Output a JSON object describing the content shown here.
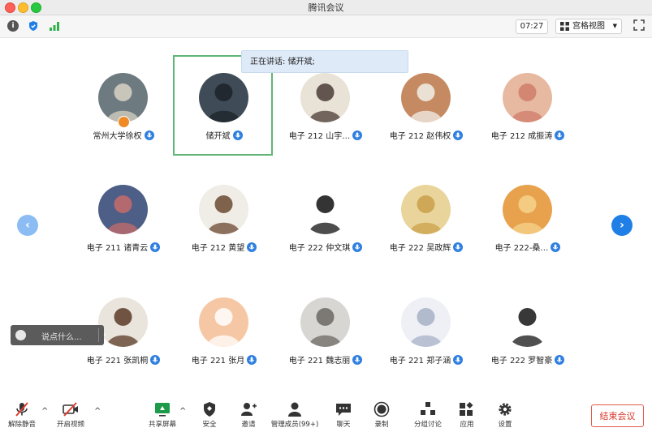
{
  "window": {
    "title": "腾讯会议"
  },
  "toolbar": {
    "timer": "07:27",
    "view_label": "宫格视图"
  },
  "speaking": {
    "text": "正在讲话: 储开斌;"
  },
  "participants": [
    {
      "name": "常州大学徐权",
      "bg": "#6d7b80",
      "fg": "#d8d2c4"
    },
    {
      "name": "储开斌",
      "bg": "#3f4c57",
      "fg": "#1c2228"
    },
    {
      "name": "电子 212 山宇…",
      "bg": "#e9e2d6",
      "fg": "#4a3b36"
    },
    {
      "name": "电子 212 赵伟权",
      "bg": "#c58a62",
      "fg": "#f1efe9"
    },
    {
      "name": "电子 212 成振涛",
      "bg": "#e6b9a0",
      "fg": "#cf7c6a"
    },
    {
      "name": "电子 211 诸青云",
      "bg": "#4d5f86",
      "fg": "#c76b6b"
    },
    {
      "name": "电子 212 黄望",
      "bg": "#f0ece6",
      "fg": "#6b4a30"
    },
    {
      "name": "电子 222 仲文琪",
      "bg": "#ffffff",
      "fg": "#111111"
    },
    {
      "name": "电子 222 吴政辉",
      "bg": "#e9d59b",
      "fg": "#c9a04a"
    },
    {
      "name": "电子 222-桑…",
      "bg": "#e8a24d",
      "fg": "#f5d38b"
    },
    {
      "name": "电子 221 张凯桐",
      "bg": "#e9e4dc",
      "fg": "#5a3a24"
    },
    {
      "name": "电子 221 张月",
      "bg": "#f6c7a4",
      "fg": "#ffffff"
    },
    {
      "name": "电子 221 魏志丽",
      "bg": "#d8d6d2",
      "fg": "#6c6864"
    },
    {
      "name": "电子 221 郑子涵",
      "bg": "#eef0f5",
      "fg": "#a7b1c6"
    },
    {
      "name": "电子 222 罗智豪",
      "bg": "#ffffff",
      "fg": "#151515"
    }
  ],
  "chat": {
    "placeholder": "说点什么..."
  },
  "bottom_tools": [
    {
      "label": "解除静音",
      "icon": "mic-muted-icon"
    },
    {
      "label": "开启视频",
      "icon": "video-off-icon"
    },
    {
      "label": "共享屏幕",
      "icon": "share-screen-icon"
    },
    {
      "label": "安全",
      "icon": "shield-icon"
    },
    {
      "label": "邀请",
      "icon": "invite-icon"
    },
    {
      "label": "管理成员(99+)",
      "icon": "members-icon"
    },
    {
      "label": "聊天",
      "icon": "chat-icon"
    },
    {
      "label": "录制",
      "icon": "record-icon"
    },
    {
      "label": "分组讨论",
      "icon": "breakout-icon"
    },
    {
      "label": "应用",
      "icon": "apps-icon"
    },
    {
      "label": "设置",
      "icon": "gear-icon"
    }
  ],
  "end_meeting": {
    "label": "结束会议"
  },
  "colors": {
    "accent": "#1f7fe6",
    "danger": "#d8382a",
    "speaking_frame": "#5fb577",
    "share_green": "#1e9b4a"
  }
}
